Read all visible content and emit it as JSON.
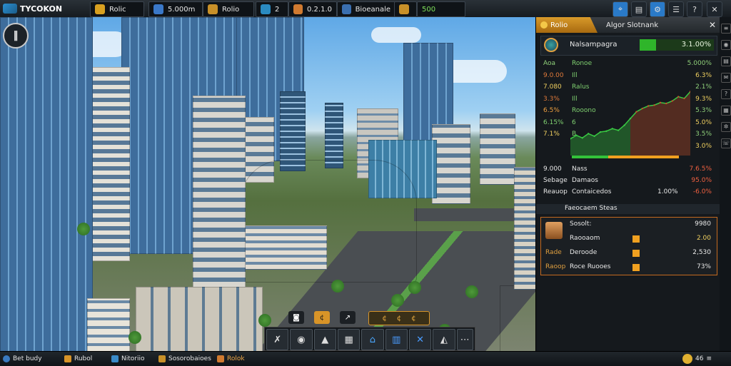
{
  "app": {
    "title": "TYCOKON"
  },
  "resources": [
    {
      "label": "Rolic",
      "icon": "coin-bag-icon",
      "color": "#d8a020"
    },
    {
      "label": "5.000m",
      "icon": "star-icon",
      "color": "#3a78c8"
    },
    {
      "label": "Rolio",
      "icon": "shield-icon",
      "color": "#c89028"
    },
    {
      "label": "2",
      "icon": "trophy-icon",
      "color": "#2a8ac0"
    },
    {
      "label": "0.2.1.0",
      "icon": "gem-icon",
      "color": "#d07a30"
    },
    {
      "label": "Bioeanale",
      "icon": "globe-icon",
      "color": "#3a6fb0"
    },
    {
      "label": "",
      "icon": "crossed-tools-icon",
      "color": "#c89028"
    },
    {
      "label": "500",
      "icon": "cash-icon",
      "color": "#4fc040"
    }
  ],
  "top_buttons": [
    "map-pin-icon",
    "chart-icon",
    "settings-icon",
    "user-icon",
    "close-icon"
  ],
  "panel": {
    "tab_label": "Rolio",
    "header_title": "Algor Slotnank",
    "close": "✕",
    "company_name": "Nalsampagra",
    "company_value": "3.1.00%",
    "left_rows": [
      "Aoa",
      "9.0.00",
      "7.080",
      "3.3%",
      "6.5%",
      "6.15%",
      "7.1%"
    ],
    "mid_rows": [
      "Ronoe",
      "Ill",
      "Ralus",
      "Ill",
      "Rooono",
      "6",
      "B"
    ],
    "right_rows": [
      "5.000%",
      "6.3%",
      "2.1%",
      "9.3%",
      "5.3%",
      "5.0%",
      "3.5%",
      "3.0%"
    ],
    "stat_rows": [
      {
        "a": "9.000",
        "b": "Nass",
        "c": "",
        "d": "7.6.5%"
      },
      {
        "a": "Sebage",
        "b": "Damaos",
        "c": "",
        "d": "95.0%"
      },
      {
        "a": "Reauop",
        "b": "Contaicedos",
        "c": "1.00%",
        "d": "-6.0%"
      }
    ],
    "section_title": "Faeocaem Steas",
    "section_value": "",
    "info_rows": [
      {
        "label": "Sosolt:",
        "value": "9980",
        "icon": "portrait-icon"
      },
      {
        "label": "Raooaom",
        "value": "2.00",
        "prefix": ""
      },
      {
        "label": "Deroode",
        "value": "2,530",
        "prefix": "Rade"
      },
      {
        "label": "Roce Ruooes",
        "value": "73%",
        "prefix": "Raoop"
      }
    ]
  },
  "chart_data": {
    "type": "area",
    "series": [
      {
        "values": [
          2.0,
          2.4,
          2.1,
          2.6,
          2.3,
          2.8,
          2.9,
          3.2,
          3.0,
          3.6,
          4.4,
          5.2,
          5.6,
          5.9,
          6.0,
          6.3,
          6.2,
          6.5,
          7.0,
          6.8,
          7.6
        ]
      }
    ],
    "ylim": [
      0,
      9
    ],
    "colors": [
      "#39c943",
      "#c8502a"
    ]
  },
  "toolbar": {
    "buttons": [
      "road-icon",
      "water-icon",
      "building-icon",
      "factory-icon",
      "house-icon",
      "office-icon",
      "tools-icon",
      "demolish-icon"
    ]
  },
  "sub_toolbar": [
    "camera-icon",
    "coin-icon",
    "arrow-icon",
    "coin-icon",
    "coin-icon",
    "coin-icon"
  ],
  "bottom": [
    {
      "label": "Bet budy",
      "icon": "globe-icon"
    },
    {
      "label": "Rubol",
      "icon": "coin-icon"
    },
    {
      "label": "Nitoriio",
      "icon": "chart-icon"
    },
    {
      "label": "Sosorobaioes",
      "icon": "shield-icon"
    },
    {
      "label": "Rolok",
      "icon": "badge-icon"
    }
  ],
  "bottom_right": {
    "value": "46"
  },
  "side_icons": [
    "list-icon",
    "eye-icon",
    "doc-icon",
    "chat-icon",
    "help-icon",
    "book-icon",
    "fan-icon",
    "phone-icon"
  ]
}
